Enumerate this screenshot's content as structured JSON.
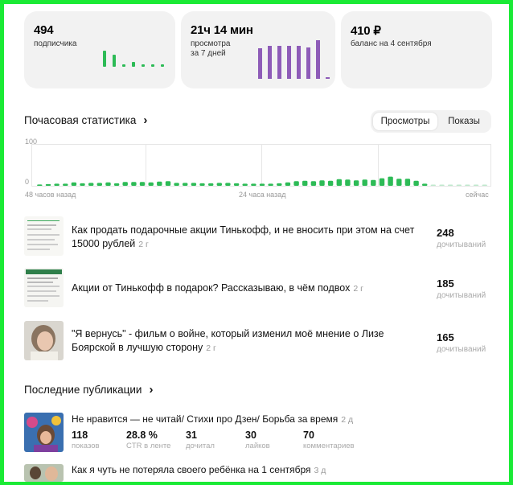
{
  "cards": [
    {
      "value": "494",
      "label": "подписчика"
    },
    {
      "value": "21ч 14 мин",
      "label_line1": "просмотра",
      "label_line2": "за 7 дней"
    },
    {
      "value": "410 ₽",
      "label": "баланс на 4 сентября"
    }
  ],
  "colors": {
    "green": "#2dbb56",
    "purple": "#8e5cb8",
    "accent_border": "#1aea35"
  },
  "hourly": {
    "title": "Почасовая статистика",
    "toggle": {
      "active": "Просмотры",
      "other": "Показы"
    },
    "x_labels": {
      "left": "48 часов назад",
      "middle": "24 часа назад",
      "right": "сейчас"
    }
  },
  "chart_data": {
    "type": "bar",
    "ylim": [
      0,
      100
    ],
    "y_ticks": [
      "100",
      "0"
    ],
    "values": [
      3,
      4,
      5,
      5,
      8,
      6,
      7,
      7,
      8,
      6,
      9,
      9,
      9,
      8,
      10,
      11,
      7,
      7,
      7,
      6,
      6,
      7,
      7,
      6,
      5,
      5,
      5,
      5,
      6,
      8,
      11,
      12,
      11,
      13,
      12,
      16,
      15,
      13,
      15,
      14,
      18,
      22,
      17,
      17,
      12,
      5,
      2,
      2,
      2,
      2,
      2,
      2,
      2
    ]
  },
  "top_articles": [
    {
      "title": "Как продать подарочные акции Тинькофф, и не вносить при этом на счет 15000 рублей",
      "age": "2 г",
      "count": "248",
      "count_label": "дочитываний"
    },
    {
      "title": "Акции от Тинькофф в подарок? Рассказываю, в чём подвох",
      "age": "2 г",
      "count": "185",
      "count_label": "дочитываний"
    },
    {
      "title": "\"Я вернусь\" - фильм о войне, который изменил моё мнение о Лизе Боярской в лучшую сторону",
      "age": "2 г",
      "count": "165",
      "count_label": "дочитываний"
    }
  ],
  "recent": {
    "title": "Последние публикации",
    "items": [
      {
        "title": "Не нравится — не читай/ Стихи про Дзен/ Борьба за время",
        "age": "2 д",
        "metrics": [
          {
            "value": "118",
            "label": "показов"
          },
          {
            "value": "28.8 %",
            "label": "CTR в ленте"
          },
          {
            "value": "31",
            "label": "дочитал"
          },
          {
            "value": "30",
            "label": "лайков"
          },
          {
            "value": "70",
            "label": "комментариев"
          }
        ]
      },
      {
        "title": "Как я чуть не потеряла своего ребёнка на 1 сентября",
        "age": "3 д"
      }
    ]
  }
}
